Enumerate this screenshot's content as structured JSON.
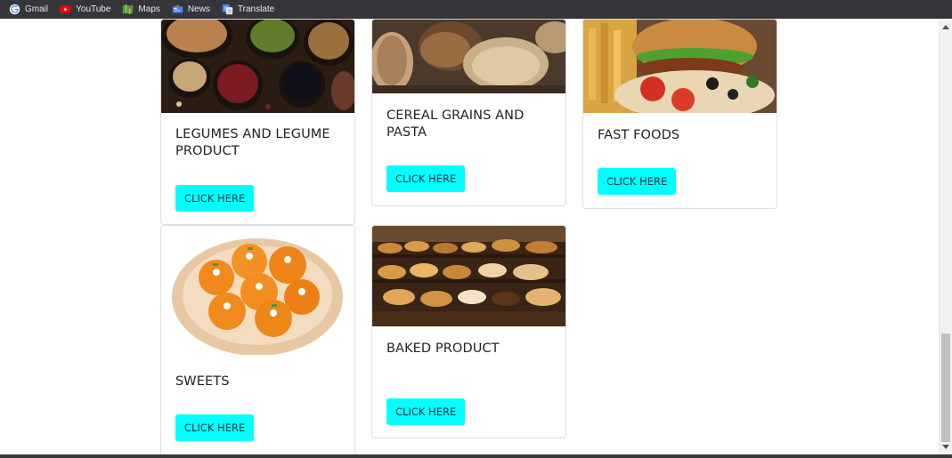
{
  "bookmarks": [
    {
      "label": "Gmail",
      "icon": "google-icon"
    },
    {
      "label": "YouTube",
      "icon": "youtube-icon"
    },
    {
      "label": "Maps",
      "icon": "maps-icon"
    },
    {
      "label": "News",
      "icon": "news-icon"
    },
    {
      "label": "Translate",
      "icon": "translate-icon"
    }
  ],
  "cards": {
    "legumes": {
      "title": "LEGUMES AND LEGUME PRODUCT",
      "button": "CLICK HERE",
      "image": "legumes-photo"
    },
    "cereal": {
      "title": "CEREAL GRAINS AND PASTA",
      "button": "CLICK HERE",
      "image": "cereal-grains-photo"
    },
    "fast": {
      "title": "FAST FOODS",
      "button": "CLICK HERE",
      "image": "fast-food-photo"
    },
    "sweets": {
      "title": "SWEETS",
      "button": "CLICK HERE",
      "image": "sweets-photo"
    },
    "baked": {
      "title": "BAKED PRODUCT",
      "button": "CLICK HERE",
      "image": "baked-goods-photo"
    }
  },
  "colors": {
    "button_bg": "#00ffff",
    "bookmarks_bar_bg": "#35363a"
  }
}
